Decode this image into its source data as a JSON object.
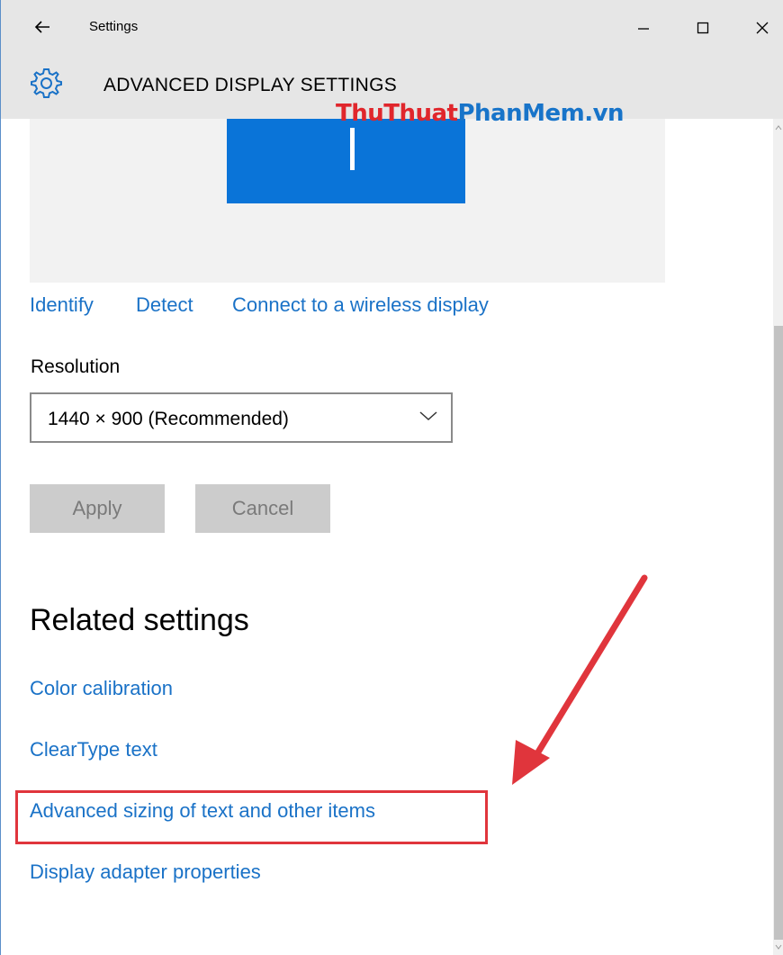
{
  "window": {
    "title": "Settings",
    "header_title": "ADVANCED DISPLAY SETTINGS"
  },
  "watermark": {
    "part1": "ThuThuat",
    "part2": "PhanMem.vn"
  },
  "display_links": {
    "identify": "Identify",
    "detect": "Detect",
    "wireless": "Connect to a wireless display"
  },
  "resolution": {
    "label": "Resolution",
    "value": "1440 × 900 (Recommended)"
  },
  "buttons": {
    "apply": "Apply",
    "cancel": "Cancel"
  },
  "related": {
    "title": "Related settings",
    "items": [
      {
        "label": "Color calibration"
      },
      {
        "label": "ClearType text"
      },
      {
        "label": "Advanced sizing of text and other items",
        "highlighted": true
      },
      {
        "label": "Display adapter properties"
      }
    ]
  },
  "colors": {
    "accent": "#1a72c7",
    "monitor": "#0a74d8",
    "annotation": "#e0353c",
    "titlebar": "#e6e6e6"
  },
  "icons": {
    "back": "back-arrow-icon",
    "minimize": "minimize-icon",
    "maximize": "maximize-icon",
    "close": "close-icon",
    "gear": "gear-icon",
    "chevron": "chevron-down-icon"
  }
}
